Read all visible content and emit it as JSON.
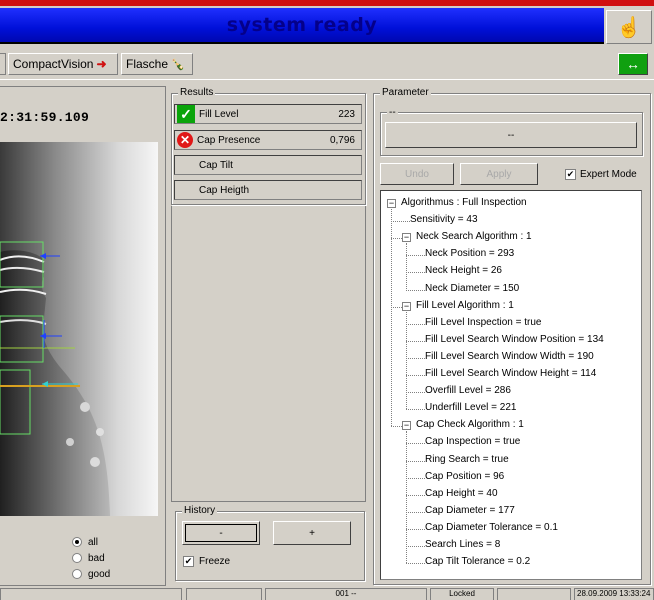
{
  "header": {
    "status": "system ready"
  },
  "toolbar": {
    "compactvision_label": "CompactVision",
    "flasche_label": "Flasche"
  },
  "image_panel": {
    "timestamp": "2:31:59.109"
  },
  "results": {
    "title": "Results",
    "rows": [
      {
        "label": "Fill Level",
        "value": "223",
        "status": "ok"
      },
      {
        "label": "Cap Presence",
        "value": "0,796",
        "status": "bad"
      },
      {
        "label": "Cap Tilt",
        "value": "",
        "status": "none"
      },
      {
        "label": "Cap Heigth",
        "value": "",
        "status": "none"
      }
    ]
  },
  "history": {
    "title": "History",
    "minus": "-",
    "plus": "+",
    "freeze_label": "Freeze",
    "freeze_checked": true
  },
  "filter": {
    "options": [
      "all",
      "bad",
      "good"
    ],
    "selected": "all"
  },
  "parameter": {
    "title": "Parameter",
    "sub_title": "--",
    "select_label": "--",
    "undo_label": "Undo",
    "apply_label": "Apply",
    "expert_mode_label": "Expert Mode",
    "expert_mode_checked": true
  },
  "tree": {
    "nodes": [
      {
        "text": "Algorithmus : Full Inspection",
        "level": 0,
        "expander": "−"
      },
      {
        "text": "Sensitivity = 43",
        "level": 1
      },
      {
        "text": "Neck Search Algorithm : 1",
        "level": 1,
        "expander": "−"
      },
      {
        "text": "Neck Position = 293",
        "level": 2
      },
      {
        "text": "Neck Height = 26",
        "level": 2
      },
      {
        "text": "Neck Diameter = 150",
        "level": 2
      },
      {
        "text": "Fill Level Algorithm : 1",
        "level": 1,
        "expander": "−"
      },
      {
        "text": "Fill Level Inspection = true",
        "level": 2
      },
      {
        "text": "Fill Level Search Window Position = 134",
        "level": 2
      },
      {
        "text": "Fill Level Search Window Width = 190",
        "level": 2
      },
      {
        "text": "Fill Level Search Window Height = 114",
        "level": 2
      },
      {
        "text": "Overfill Level = 286",
        "level": 2
      },
      {
        "text": "Underfill Level = 221",
        "level": 2
      },
      {
        "text": "Cap Check Algorithm : 1",
        "level": 1,
        "expander": "−"
      },
      {
        "text": "Cap Inspection = true",
        "level": 2
      },
      {
        "text": "Ring Search = true",
        "level": 2
      },
      {
        "text": "Cap Position = 96",
        "level": 2
      },
      {
        "text": "Cap Height = 40",
        "level": 2
      },
      {
        "text": "Cap Diameter = 177",
        "level": 2
      },
      {
        "text": "Cap Diameter Tolerance = 0.1",
        "level": 2
      },
      {
        "text": "Search Lines = 8",
        "level": 2
      },
      {
        "text": "Cap Tilt Tolerance = 0.2",
        "level": 2
      }
    ]
  },
  "statusbar": {
    "cells": [
      "",
      "",
      "001 --",
      "Locked",
      "",
      "28.09.2009 13:33:24"
    ]
  },
  "colors": {
    "title_bar": "#0010d8",
    "title_text": "#04008a",
    "ok": "#0aa40a",
    "bad": "#e01818",
    "accent_red": "#d01010"
  },
  "icons": {
    "home": "hand-icon",
    "exchange": "double-arrow-icon",
    "flasche": "bottle-icon"
  }
}
